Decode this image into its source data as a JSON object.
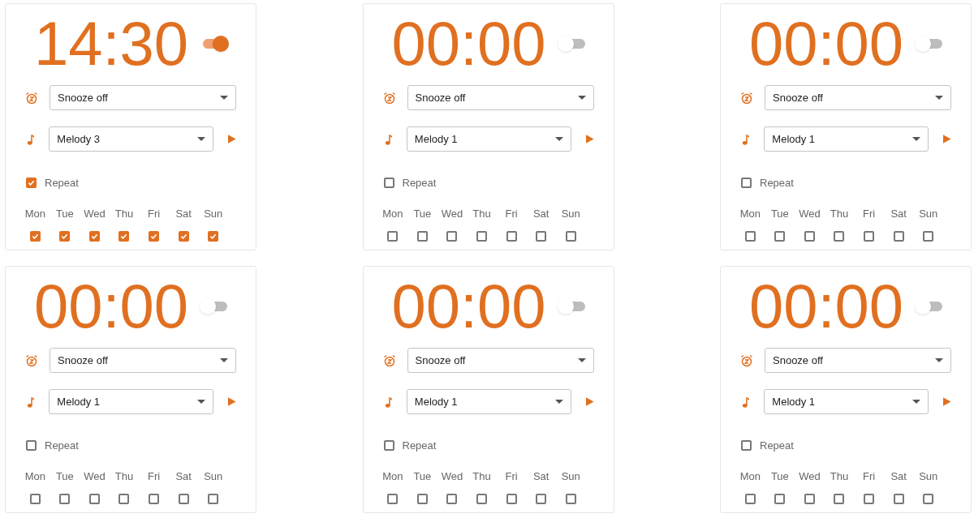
{
  "alarms": [
    {
      "time": "14:30",
      "on": true,
      "snooze": "Snooze off",
      "melody": "Melody 3",
      "repeat": {
        "label": "Repeat",
        "checked": true
      },
      "days": [
        {
          "label": "Mon",
          "checked": true
        },
        {
          "label": "Tue",
          "checked": true
        },
        {
          "label": "Wed",
          "checked": true
        },
        {
          "label": "Thu",
          "checked": true
        },
        {
          "label": "Fri",
          "checked": true
        },
        {
          "label": "Sat",
          "checked": true
        },
        {
          "label": "Sun",
          "checked": true
        }
      ]
    },
    {
      "time": "00:00",
      "on": false,
      "snooze": "Snooze off",
      "melody": "Melody 1",
      "repeat": {
        "label": "Repeat",
        "checked": false
      },
      "days": [
        {
          "label": "Mon",
          "checked": false
        },
        {
          "label": "Tue",
          "checked": false
        },
        {
          "label": "Wed",
          "checked": false
        },
        {
          "label": "Thu",
          "checked": false
        },
        {
          "label": "Fri",
          "checked": false
        },
        {
          "label": "Sat",
          "checked": false
        },
        {
          "label": "Sun",
          "checked": false
        }
      ]
    },
    {
      "time": "00:00",
      "on": false,
      "snooze": "Snooze off",
      "melody": "Melody 1",
      "repeat": {
        "label": "Repeat",
        "checked": false
      },
      "days": [
        {
          "label": "Mon",
          "checked": false
        },
        {
          "label": "Tue",
          "checked": false
        },
        {
          "label": "Wed",
          "checked": false
        },
        {
          "label": "Thu",
          "checked": false
        },
        {
          "label": "Fri",
          "checked": false
        },
        {
          "label": "Sat",
          "checked": false
        },
        {
          "label": "Sun",
          "checked": false
        }
      ]
    },
    {
      "time": "00:00",
      "on": false,
      "snooze": "Snooze off",
      "melody": "Melody 1",
      "repeat": {
        "label": "Repeat",
        "checked": false
      },
      "days": [
        {
          "label": "Mon",
          "checked": false
        },
        {
          "label": "Tue",
          "checked": false
        },
        {
          "label": "Wed",
          "checked": false
        },
        {
          "label": "Thu",
          "checked": false
        },
        {
          "label": "Fri",
          "checked": false
        },
        {
          "label": "Sat",
          "checked": false
        },
        {
          "label": "Sun",
          "checked": false
        }
      ]
    },
    {
      "time": "00:00",
      "on": false,
      "snooze": "Snooze off",
      "melody": "Melody 1",
      "repeat": {
        "label": "Repeat",
        "checked": false
      },
      "days": [
        {
          "label": "Mon",
          "checked": false
        },
        {
          "label": "Tue",
          "checked": false
        },
        {
          "label": "Wed",
          "checked": false
        },
        {
          "label": "Thu",
          "checked": false
        },
        {
          "label": "Fri",
          "checked": false
        },
        {
          "label": "Sat",
          "checked": false
        },
        {
          "label": "Sun",
          "checked": false
        }
      ]
    },
    {
      "time": "00:00",
      "on": false,
      "snooze": "Snooze off",
      "melody": "Melody 1",
      "repeat": {
        "label": "Repeat",
        "checked": false
      },
      "days": [
        {
          "label": "Mon",
          "checked": false
        },
        {
          "label": "Tue",
          "checked": false
        },
        {
          "label": "Wed",
          "checked": false
        },
        {
          "label": "Thu",
          "checked": false
        },
        {
          "label": "Fri",
          "checked": false
        },
        {
          "label": "Sat",
          "checked": false
        },
        {
          "label": "Sun",
          "checked": false
        }
      ]
    }
  ]
}
